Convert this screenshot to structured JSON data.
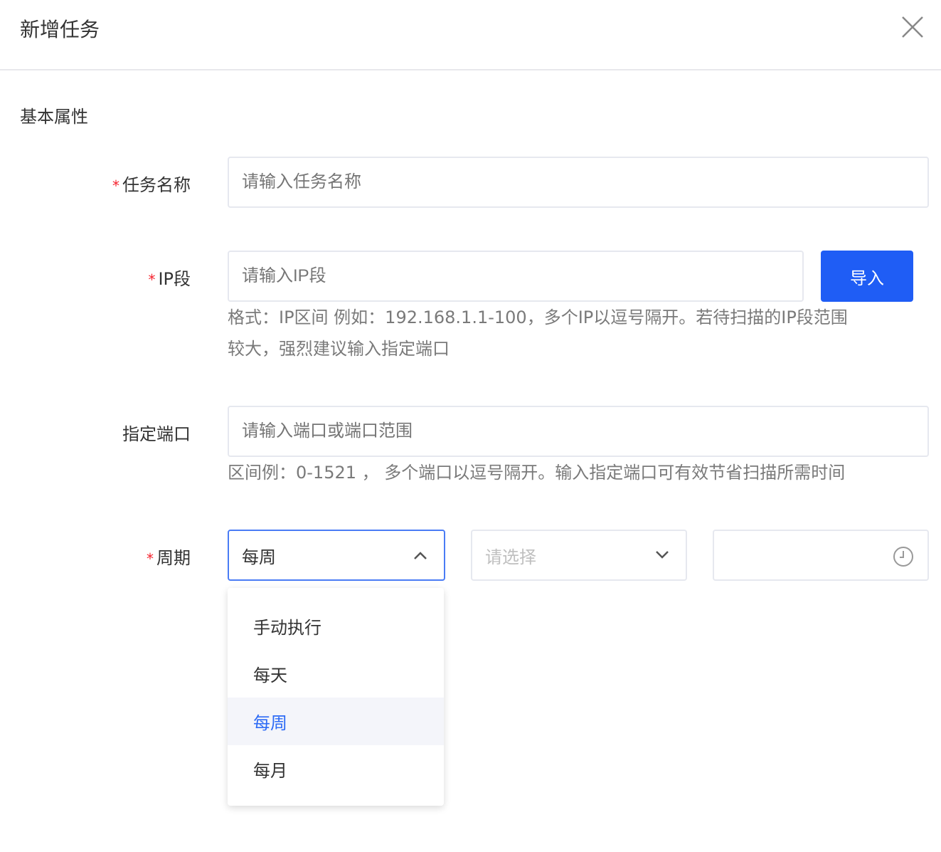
{
  "dialog": {
    "title": "新增任务",
    "close_icon": "close-icon"
  },
  "section_title": "基本属性",
  "fields": {
    "task_name": {
      "label": "任务名称",
      "required": "*",
      "placeholder": "请输入任务名称",
      "value": ""
    },
    "ip_range": {
      "label": "IP段",
      "required": "*",
      "placeholder": "请输入IP段",
      "value": "",
      "import_label": "导入",
      "help_line1": "格式：IP区间 例如：192.168.1.1-100，多个IP以逗号隔开。若待扫描的IP段范围",
      "help_line2": "较大，强烈建议输入指定端口"
    },
    "port": {
      "label": "指定端口",
      "placeholder": "请输入端口或端口范围",
      "value": "",
      "help": "区间例：0-1521 ， 多个端口以逗号隔开。输入指定端口可有效节省扫描所需时间"
    },
    "period": {
      "label": "周期",
      "required": "*",
      "selected": "每周",
      "second_placeholder": "请选择",
      "time_value": "",
      "options": [
        "手动执行",
        "每天",
        "每周",
        "每月"
      ],
      "selected_index": 2
    }
  },
  "colors": {
    "primary": "#1f5df5",
    "required": "#f5222d"
  }
}
